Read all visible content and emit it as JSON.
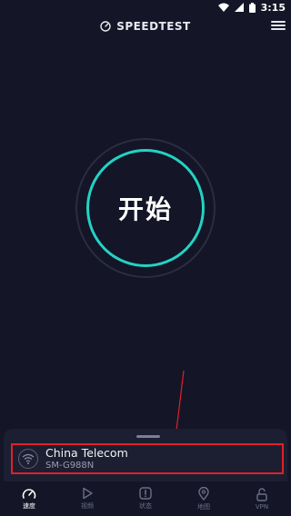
{
  "status_bar": {
    "time": "3:15"
  },
  "header": {
    "brand": "SPEEDTEST"
  },
  "start_button": {
    "label": "开始"
  },
  "network": {
    "name": "China Telecom",
    "device": "SM-G988N"
  },
  "bottom_nav": {
    "items": [
      {
        "label": "速度",
        "icon": "speed-gauge-icon",
        "active": true
      },
      {
        "label": "视频",
        "icon": "play-icon",
        "active": false
      },
      {
        "label": "状态",
        "icon": "alert-icon",
        "active": false
      },
      {
        "label": "地图",
        "icon": "map-pin-icon",
        "active": false
      },
      {
        "label": "VPN",
        "icon": "lock-icon",
        "active": false
      }
    ]
  },
  "colors": {
    "background": "#141526",
    "accent": "#22d3c5",
    "annotation": "#e1202a"
  }
}
